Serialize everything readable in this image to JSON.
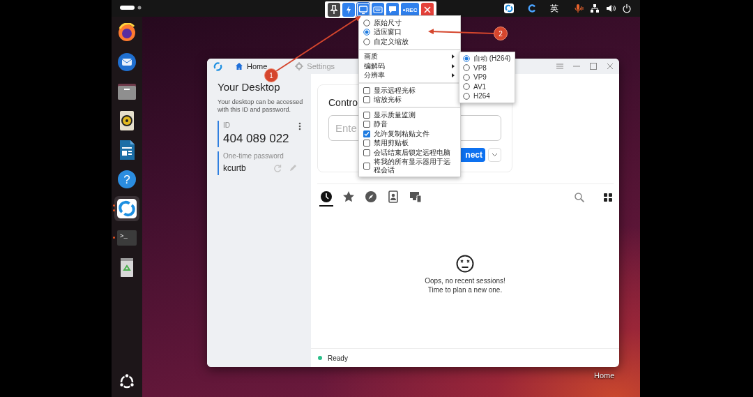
{
  "top_bar": {
    "input_method": "英"
  },
  "dock": {
    "apps": [
      {
        "kind": "firefox",
        "selected": false,
        "running": false,
        "multiple_windows": false
      },
      {
        "kind": "thunderbird",
        "selected": false,
        "running": false,
        "multiple_windows": false
      },
      {
        "kind": "files",
        "selected": false,
        "running": false,
        "multiple_windows": false
      },
      {
        "kind": "rhythmbox",
        "selected": false,
        "running": false,
        "multiple_windows": false
      },
      {
        "kind": "writer",
        "selected": false,
        "running": false,
        "multiple_windows": false
      },
      {
        "kind": "help",
        "glyph": "?",
        "selected": false,
        "running": false,
        "multiple_windows": false
      },
      {
        "kind": "rustdesk",
        "selected": true,
        "running": true,
        "multiple_windows": true
      },
      {
        "kind": "terminal",
        "glyph": ">_",
        "selected": false,
        "running": true,
        "multiple_windows": false
      },
      {
        "kind": "trash",
        "selected": false,
        "running": false,
        "multiple_windows": false
      }
    ]
  },
  "window": {
    "tabs": [
      {
        "label": "Home",
        "selected": true
      },
      {
        "label": "Settings",
        "selected": false
      }
    ],
    "sidebar": {
      "title": "Your Desktop",
      "description": "Your desktop can be accessed with this ID and password.",
      "id_label": "ID",
      "id_value": "404 089 022",
      "password_label": "One-time password",
      "password_value": "kcurtb"
    },
    "control_card": {
      "title": "Contro",
      "field_placeholder": "Ente",
      "connect_label": "nect"
    },
    "session_tabs": [
      {
        "kind": "recent",
        "selected": true
      },
      {
        "kind": "favorites",
        "selected": false
      },
      {
        "kind": "discovered",
        "selected": false
      },
      {
        "kind": "address_book",
        "selected": false
      },
      {
        "kind": "devices",
        "selected": false
      }
    ],
    "empty_state": {
      "title": "Oops, no recent sessions!",
      "subtitle": "Time to plan a new one."
    },
    "status": {
      "label": "Ready"
    }
  },
  "remote_toolbar": {
    "buttons": [
      {
        "kind": "pin",
        "selected": false
      },
      {
        "kind": "action",
        "selected": false
      },
      {
        "kind": "display",
        "selected": true
      },
      {
        "kind": "keyboard",
        "selected": false
      },
      {
        "kind": "chat",
        "selected": false
      },
      {
        "kind": "record",
        "label": "REC",
        "selected": false
      },
      {
        "kind": "close",
        "selected": false
      }
    ]
  },
  "display_menu": {
    "items": [
      {
        "kind": "radio",
        "label": "原始尺寸",
        "selected": false
      },
      {
        "kind": "radio",
        "label": "适应窗口",
        "selected": true
      },
      {
        "kind": "radio",
        "label": "自定义缩放",
        "selected": false
      },
      {
        "kind": "separator"
      },
      {
        "kind": "submenu",
        "label": "画质"
      },
      {
        "kind": "submenu",
        "label": "编解码"
      },
      {
        "kind": "submenu",
        "label": "分辨率"
      },
      {
        "kind": "separator"
      },
      {
        "kind": "checkbox",
        "label": "显示远程光标",
        "checked": false
      },
      {
        "kind": "checkbox",
        "label": "缩放光标",
        "checked": false
      },
      {
        "kind": "separator"
      },
      {
        "kind": "checkbox",
        "label": "显示质量监测",
        "checked": false
      },
      {
        "kind": "checkbox",
        "label": "静音",
        "checked": false
      },
      {
        "kind": "checkbox",
        "label": "允许复制粘贴文件",
        "checked": true
      },
      {
        "kind": "checkbox",
        "label": "禁用剪贴板",
        "checked": false
      },
      {
        "kind": "checkbox",
        "label": "会话结束后锁定远程电脑",
        "checked": false
      },
      {
        "kind": "checkbox",
        "label": "将我的所有显示器用于远程会话",
        "checked": false
      }
    ]
  },
  "codec_submenu": {
    "items": [
      {
        "label": "自动 (H264)",
        "selected": true
      },
      {
        "label": "VP8",
        "selected": false
      },
      {
        "label": "VP9",
        "selected": false
      },
      {
        "label": "AV1",
        "selected": false
      },
      {
        "label": "H264",
        "selected": false
      }
    ]
  },
  "desktop_label": "Home",
  "annotations": [
    {
      "number": "1"
    },
    {
      "number": "2"
    }
  ]
}
